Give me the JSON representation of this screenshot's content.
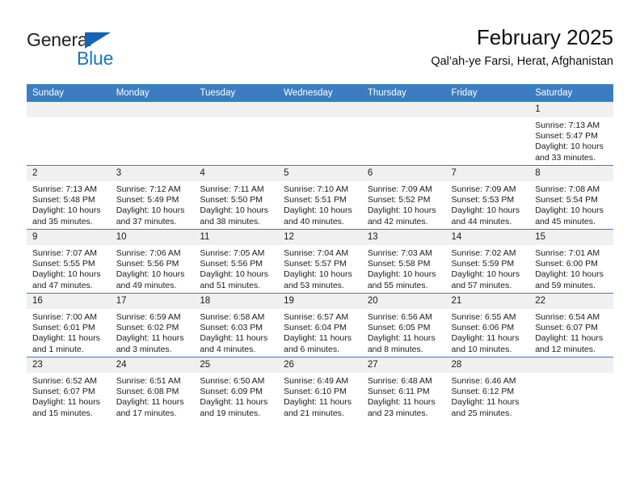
{
  "brand": {
    "name_part1": "General",
    "name_part2": "Blue",
    "accent_color": "#1874bd",
    "triangle_icon": "brand-triangle-icon"
  },
  "header": {
    "title": "February 2025",
    "subtitle": "Qal’ah-ye Farsi, Herat, Afghanistan"
  },
  "calendar": {
    "header_bg": "#3b7dc0",
    "daynum_bg": "#f0f0f0",
    "weekday_headers": [
      "Sunday",
      "Monday",
      "Tuesday",
      "Wednesday",
      "Thursday",
      "Friday",
      "Saturday"
    ],
    "weeks": [
      [
        {
          "day": "",
          "sunrise": "",
          "sunset": "",
          "daylight": "",
          "empty": true
        },
        {
          "day": "",
          "sunrise": "",
          "sunset": "",
          "daylight": "",
          "empty": true
        },
        {
          "day": "",
          "sunrise": "",
          "sunset": "",
          "daylight": "",
          "empty": true
        },
        {
          "day": "",
          "sunrise": "",
          "sunset": "",
          "daylight": "",
          "empty": true
        },
        {
          "day": "",
          "sunrise": "",
          "sunset": "",
          "daylight": "",
          "empty": true
        },
        {
          "day": "",
          "sunrise": "",
          "sunset": "",
          "daylight": "",
          "empty": true
        },
        {
          "day": "1",
          "sunrise": "Sunrise: 7:13 AM",
          "sunset": "Sunset: 5:47 PM",
          "daylight": "Daylight: 10 hours and 33 minutes."
        }
      ],
      [
        {
          "day": "2",
          "sunrise": "Sunrise: 7:13 AM",
          "sunset": "Sunset: 5:48 PM",
          "daylight": "Daylight: 10 hours and 35 minutes."
        },
        {
          "day": "3",
          "sunrise": "Sunrise: 7:12 AM",
          "sunset": "Sunset: 5:49 PM",
          "daylight": "Daylight: 10 hours and 37 minutes."
        },
        {
          "day": "4",
          "sunrise": "Sunrise: 7:11 AM",
          "sunset": "Sunset: 5:50 PM",
          "daylight": "Daylight: 10 hours and 38 minutes."
        },
        {
          "day": "5",
          "sunrise": "Sunrise: 7:10 AM",
          "sunset": "Sunset: 5:51 PM",
          "daylight": "Daylight: 10 hours and 40 minutes."
        },
        {
          "day": "6",
          "sunrise": "Sunrise: 7:09 AM",
          "sunset": "Sunset: 5:52 PM",
          "daylight": "Daylight: 10 hours and 42 minutes."
        },
        {
          "day": "7",
          "sunrise": "Sunrise: 7:09 AM",
          "sunset": "Sunset: 5:53 PM",
          "daylight": "Daylight: 10 hours and 44 minutes."
        },
        {
          "day": "8",
          "sunrise": "Sunrise: 7:08 AM",
          "sunset": "Sunset: 5:54 PM",
          "daylight": "Daylight: 10 hours and 45 minutes."
        }
      ],
      [
        {
          "day": "9",
          "sunrise": "Sunrise: 7:07 AM",
          "sunset": "Sunset: 5:55 PM",
          "daylight": "Daylight: 10 hours and 47 minutes."
        },
        {
          "day": "10",
          "sunrise": "Sunrise: 7:06 AM",
          "sunset": "Sunset: 5:56 PM",
          "daylight": "Daylight: 10 hours and 49 minutes."
        },
        {
          "day": "11",
          "sunrise": "Sunrise: 7:05 AM",
          "sunset": "Sunset: 5:56 PM",
          "daylight": "Daylight: 10 hours and 51 minutes."
        },
        {
          "day": "12",
          "sunrise": "Sunrise: 7:04 AM",
          "sunset": "Sunset: 5:57 PM",
          "daylight": "Daylight: 10 hours and 53 minutes."
        },
        {
          "day": "13",
          "sunrise": "Sunrise: 7:03 AM",
          "sunset": "Sunset: 5:58 PM",
          "daylight": "Daylight: 10 hours and 55 minutes."
        },
        {
          "day": "14",
          "sunrise": "Sunrise: 7:02 AM",
          "sunset": "Sunset: 5:59 PM",
          "daylight": "Daylight: 10 hours and 57 minutes."
        },
        {
          "day": "15",
          "sunrise": "Sunrise: 7:01 AM",
          "sunset": "Sunset: 6:00 PM",
          "daylight": "Daylight: 10 hours and 59 minutes."
        }
      ],
      [
        {
          "day": "16",
          "sunrise": "Sunrise: 7:00 AM",
          "sunset": "Sunset: 6:01 PM",
          "daylight": "Daylight: 11 hours and 1 minute."
        },
        {
          "day": "17",
          "sunrise": "Sunrise: 6:59 AM",
          "sunset": "Sunset: 6:02 PM",
          "daylight": "Daylight: 11 hours and 3 minutes."
        },
        {
          "day": "18",
          "sunrise": "Sunrise: 6:58 AM",
          "sunset": "Sunset: 6:03 PM",
          "daylight": "Daylight: 11 hours and 4 minutes."
        },
        {
          "day": "19",
          "sunrise": "Sunrise: 6:57 AM",
          "sunset": "Sunset: 6:04 PM",
          "daylight": "Daylight: 11 hours and 6 minutes."
        },
        {
          "day": "20",
          "sunrise": "Sunrise: 6:56 AM",
          "sunset": "Sunset: 6:05 PM",
          "daylight": "Daylight: 11 hours and 8 minutes."
        },
        {
          "day": "21",
          "sunrise": "Sunrise: 6:55 AM",
          "sunset": "Sunset: 6:06 PM",
          "daylight": "Daylight: 11 hours and 10 minutes."
        },
        {
          "day": "22",
          "sunrise": "Sunrise: 6:54 AM",
          "sunset": "Sunset: 6:07 PM",
          "daylight": "Daylight: 11 hours and 12 minutes."
        }
      ],
      [
        {
          "day": "23",
          "sunrise": "Sunrise: 6:52 AM",
          "sunset": "Sunset: 6:07 PM",
          "daylight": "Daylight: 11 hours and 15 minutes."
        },
        {
          "day": "24",
          "sunrise": "Sunrise: 6:51 AM",
          "sunset": "Sunset: 6:08 PM",
          "daylight": "Daylight: 11 hours and 17 minutes."
        },
        {
          "day": "25",
          "sunrise": "Sunrise: 6:50 AM",
          "sunset": "Sunset: 6:09 PM",
          "daylight": "Daylight: 11 hours and 19 minutes."
        },
        {
          "day": "26",
          "sunrise": "Sunrise: 6:49 AM",
          "sunset": "Sunset: 6:10 PM",
          "daylight": "Daylight: 11 hours and 21 minutes."
        },
        {
          "day": "27",
          "sunrise": "Sunrise: 6:48 AM",
          "sunset": "Sunset: 6:11 PM",
          "daylight": "Daylight: 11 hours and 23 minutes."
        },
        {
          "day": "28",
          "sunrise": "Sunrise: 6:46 AM",
          "sunset": "Sunset: 6:12 PM",
          "daylight": "Daylight: 11 hours and 25 minutes."
        },
        {
          "day": "",
          "sunrise": "",
          "sunset": "",
          "daylight": "",
          "empty": true
        }
      ]
    ]
  }
}
